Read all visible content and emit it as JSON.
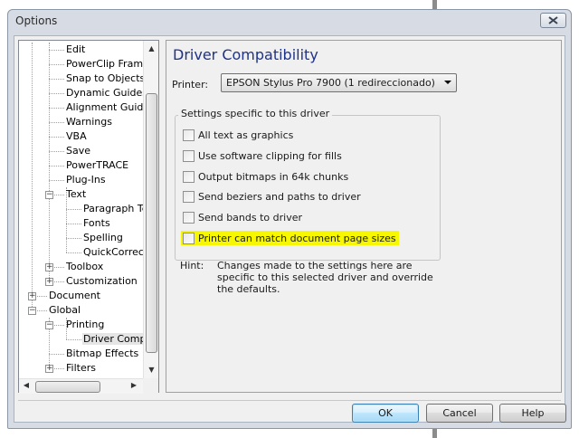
{
  "window": {
    "title": "Options"
  },
  "tree": {
    "items": [
      {
        "label": "Edit",
        "indent": 2
      },
      {
        "label": "PowerClip Frame",
        "indent": 2
      },
      {
        "label": "Snap to Objects",
        "indent": 2
      },
      {
        "label": "Dynamic Guides",
        "indent": 2
      },
      {
        "label": "Alignment Guides",
        "indent": 2
      },
      {
        "label": "Warnings",
        "indent": 2
      },
      {
        "label": "VBA",
        "indent": 2
      },
      {
        "label": "Save",
        "indent": 2
      },
      {
        "label": "PowerTRACE",
        "indent": 2
      },
      {
        "label": "Plug-Ins",
        "indent": 2
      },
      {
        "label": "Text",
        "indent": 2,
        "expander": "minus"
      },
      {
        "label": "Paragraph Tex",
        "indent": 3
      },
      {
        "label": "Fonts",
        "indent": 3
      },
      {
        "label": "Spelling",
        "indent": 3
      },
      {
        "label": "QuickCorrect",
        "indent": 3
      },
      {
        "label": "Toolbox",
        "indent": 2,
        "expander": "plus"
      },
      {
        "label": "Customization",
        "indent": 2,
        "expander": "plus"
      },
      {
        "label": "Document",
        "indent": 1,
        "expander": "plus"
      },
      {
        "label": "Global",
        "indent": 1,
        "expander": "minus"
      },
      {
        "label": "Printing",
        "indent": 2,
        "expander": "minus"
      },
      {
        "label": "Driver Compati",
        "indent": 3,
        "selected": true
      },
      {
        "label": "Bitmap Effects",
        "indent": 2
      },
      {
        "label": "Filters",
        "indent": 2,
        "expander": "plus"
      }
    ]
  },
  "panel": {
    "title": "Driver Compatibility",
    "printer_label": "Printer:",
    "printer_value": "EPSON Stylus Pro 7900 (1 redireccionado)",
    "group_label": "Settings specific to this driver",
    "options": [
      {
        "label": "All text as graphics",
        "checked": false
      },
      {
        "label": "Use software clipping for fills",
        "checked": false
      },
      {
        "label": "Output bitmaps in 64k chunks",
        "checked": false
      },
      {
        "label": "Send beziers and paths to driver",
        "checked": false
      },
      {
        "label": "Send bands to driver",
        "checked": false
      },
      {
        "label": "Printer can match document page sizes",
        "checked": false,
        "highlighted": true
      }
    ],
    "hint_label": "Hint:",
    "hint_text": "Changes made to the settings here are specific to this selected driver and override the defaults."
  },
  "buttons": {
    "ok": "OK",
    "cancel": "Cancel",
    "help": "Help"
  },
  "colors": {
    "panel_title": "#1e3287",
    "highlight": "#f6f700",
    "default_button": "#bee6fd"
  }
}
